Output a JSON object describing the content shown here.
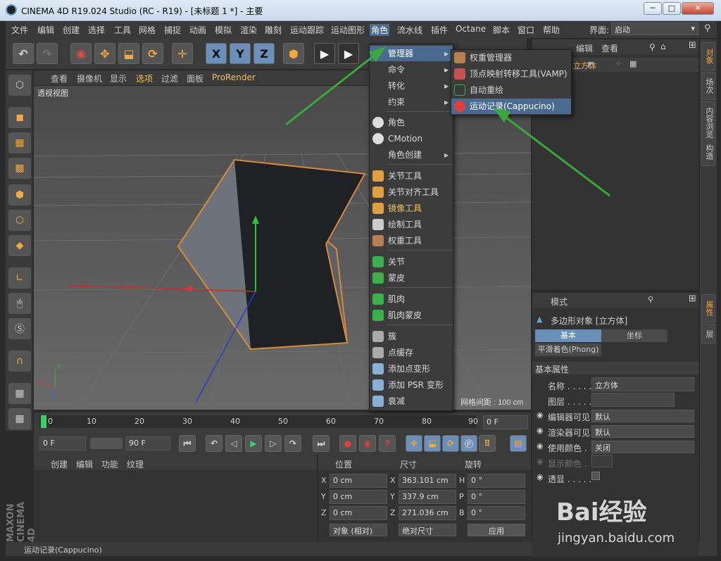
{
  "window": {
    "title": "CINEMA 4D R19.024 Studio (RC - R19) - [未标题 1 *] - 主要",
    "btn_min": "─",
    "btn_max": "□",
    "btn_close": "✕"
  },
  "menubar": {
    "items": [
      "文件",
      "编辑",
      "创建",
      "选择",
      "工具",
      "网格",
      "捕捉",
      "动画",
      "模拟",
      "渲染",
      "雕刻",
      "运动跟踪",
      "运动图形",
      "角色",
      "流水线",
      "插件",
      "Octane",
      "脚本",
      "窗口",
      "帮助"
    ],
    "layout_label": "界面:",
    "layout_value": "启动"
  },
  "toolbar": {
    "undo": "↶",
    "redo": "↷",
    "x": "X",
    "y": "Y",
    "z": "Z"
  },
  "viewport": {
    "menu": [
      "查看",
      "摄像机",
      "显示",
      "选项",
      "过滤",
      "面板"
    ],
    "prorender": "ProRender",
    "label": "透视视图",
    "grid_spacing": "网格间距 : 100 cm"
  },
  "timeline": {
    "ticks": [
      "0",
      "10",
      "20",
      "30",
      "40",
      "50",
      "60",
      "70",
      "80",
      "90"
    ],
    "frame_field": "0 F"
  },
  "playback": {
    "start": "0 F",
    "end": "90 F"
  },
  "materials": {
    "menu": [
      "创建",
      "编辑",
      "功能",
      "纹理"
    ]
  },
  "coords": {
    "headers": [
      "位置",
      "尺寸",
      "旋转"
    ],
    "rows": [
      {
        "axis": "X",
        "pos": "0 cm",
        "size_label": "X",
        "size": "363.101 cm",
        "rot_label": "H",
        "rot": "0 °"
      },
      {
        "axis": "Y",
        "pos": "0 cm",
        "size_label": "Y",
        "size": "337.9 cm",
        "rot_label": "P",
        "rot": "0 °"
      },
      {
        "axis": "Z",
        "pos": "0 cm",
        "size_label": "Z",
        "size": "271.036 cm",
        "rot_label": "B",
        "rot": "0 °"
      }
    ],
    "mode": "对象 (相对)",
    "size_mode": "绝对尺寸",
    "apply": "应用"
  },
  "status": "运动记录(Cappucino)",
  "objmgr": {
    "menu": [
      "编辑",
      "查看"
    ],
    "obj": "立方体"
  },
  "attrmgr": {
    "mode": "模式",
    "object": "多边形对象 [立方体]",
    "tabs": [
      "基本",
      "坐标"
    ],
    "tab_phong": "平滑着色(Phong)",
    "section": "基本属性",
    "rows": [
      {
        "label": "名称 . . . . .",
        "value": "立方体"
      },
      {
        "label": "图层 . . . . .",
        "value": ""
      },
      {
        "label": "编辑器可见",
        "value": "默认"
      },
      {
        "label": "渲染器可见",
        "value": "默认"
      },
      {
        "label": "使用颜色 .",
        "value": "关闭"
      },
      {
        "label": "显示颜色 .",
        "value": ""
      },
      {
        "label": "透显 . . . . .",
        "value": ""
      }
    ]
  },
  "righttabs": [
    "对象",
    "场次",
    "内容浏览器",
    "构造"
  ],
  "righttabs2": [
    "属性",
    "层"
  ],
  "menu_character": {
    "items": [
      {
        "label": "管理器",
        "sub": true,
        "hl": true
      },
      {
        "label": "命令",
        "sub": true
      },
      {
        "label": "转化",
        "sub": true
      },
      {
        "label": "约束",
        "sub": true
      },
      {
        "label": "角色"
      },
      {
        "label": "CMotion"
      },
      {
        "label": "角色创建",
        "sub": true
      },
      {
        "label": "关节工具"
      },
      {
        "label": "关节对齐工具"
      },
      {
        "label": "镜像工具"
      },
      {
        "label": "绘制工具"
      },
      {
        "label": "权重工具"
      },
      {
        "label": "关节"
      },
      {
        "label": "蒙皮"
      },
      {
        "label": "肌肉"
      },
      {
        "label": "肌肉蒙皮"
      },
      {
        "label": "簇"
      },
      {
        "label": "点缓存"
      },
      {
        "label": "添加点变形"
      },
      {
        "label": "添加 PSR 变形"
      },
      {
        "label": "衰减"
      }
    ]
  },
  "menu_manager": {
    "items": [
      "权重管理器",
      "顶点映射转移工具(VAMP)",
      "自动重绘",
      "运动记录(Cappucino)"
    ]
  },
  "watermark": {
    "text": "Bai经验",
    "url": "jingyan.baidu.com"
  },
  "maxon": "MAXON CINEMA 4D",
  "colors": {
    "accent": "#4a6b8f",
    "arrow_green": "#3aa83a"
  }
}
